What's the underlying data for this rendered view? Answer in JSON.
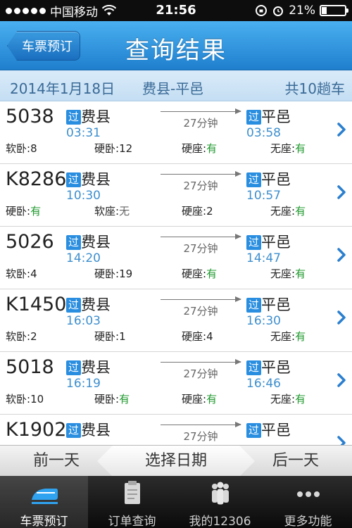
{
  "status_bar": {
    "carrier": "中国移动",
    "time": "21:56",
    "battery": "21%",
    "battery_level": 0.21
  },
  "nav": {
    "back_label": "车票预订",
    "title": "查询结果"
  },
  "info": {
    "date": "2014年1月18日",
    "route": "费县-平邑",
    "count": "共10趟车"
  },
  "trains": [
    {
      "number": "5038",
      "badge_from": "过",
      "from": "费县",
      "badge_to": "过",
      "to": "平邑",
      "duration": "27分钟",
      "depart": "03:31",
      "arrive": "03:58",
      "seats": [
        {
          "label": "软卧:",
          "value": "8",
          "color": "normal"
        },
        {
          "label": "硬卧:",
          "value": "12",
          "color": "normal"
        },
        {
          "label": "硬座:",
          "value": "有",
          "color": "green"
        },
        {
          "label": "无座:",
          "value": "有",
          "color": "green"
        }
      ]
    },
    {
      "number": "K8286",
      "badge_from": "过",
      "from": "费县",
      "badge_to": "过",
      "to": "平邑",
      "duration": "27分钟",
      "depart": "10:30",
      "arrive": "10:57",
      "seats": [
        {
          "label": "硬卧:",
          "value": "有",
          "color": "green"
        },
        {
          "label": "软座:",
          "value": "无",
          "color": "none"
        },
        {
          "label": "硬座:",
          "value": "2",
          "color": "normal"
        },
        {
          "label": "无座:",
          "value": "有",
          "color": "green"
        }
      ]
    },
    {
      "number": "5026",
      "badge_from": "过",
      "from": "费县",
      "badge_to": "过",
      "to": "平邑",
      "duration": "27分钟",
      "depart": "14:20",
      "arrive": "14:47",
      "seats": [
        {
          "label": "软卧:",
          "value": "4",
          "color": "normal"
        },
        {
          "label": "硬卧:",
          "value": "19",
          "color": "normal"
        },
        {
          "label": "硬座:",
          "value": "有",
          "color": "green"
        },
        {
          "label": "无座:",
          "value": "有",
          "color": "green"
        }
      ]
    },
    {
      "number": "K1450",
      "badge_from": "过",
      "from": "费县",
      "badge_to": "过",
      "to": "平邑",
      "duration": "27分钟",
      "depart": "16:03",
      "arrive": "16:30",
      "seats": [
        {
          "label": "软卧:",
          "value": "2",
          "color": "normal"
        },
        {
          "label": "硬卧:",
          "value": "1",
          "color": "normal"
        },
        {
          "label": "硬座:",
          "value": "4",
          "color": "normal"
        },
        {
          "label": "无座:",
          "value": "有",
          "color": "green"
        }
      ]
    },
    {
      "number": "5018",
      "badge_from": "过",
      "from": "费县",
      "badge_to": "过",
      "to": "平邑",
      "duration": "27分钟",
      "depart": "16:19",
      "arrive": "16:46",
      "seats": [
        {
          "label": "软卧:",
          "value": "10",
          "color": "normal"
        },
        {
          "label": "硬卧:",
          "value": "有",
          "color": "green"
        },
        {
          "label": "硬座:",
          "value": "有",
          "color": "green"
        },
        {
          "label": "无座:",
          "value": "有",
          "color": "green"
        }
      ]
    },
    {
      "number": "K1902",
      "badge_from": "过",
      "from": "费县",
      "badge_to": "过",
      "to": "平邑",
      "duration": "27分钟",
      "depart": "",
      "arrive": "",
      "seats": []
    }
  ],
  "date_bar": {
    "prev": "前一天",
    "select": "选择日期",
    "next": "后一天"
  },
  "tabs": [
    {
      "label": "车票预订",
      "icon": "train-icon",
      "active": true
    },
    {
      "label": "订单查询",
      "icon": "clipboard-icon",
      "active": false
    },
    {
      "label": "我的12306",
      "icon": "people-icon",
      "active": false
    },
    {
      "label": "更多功能",
      "icon": "more-icon",
      "active": false
    }
  ],
  "colors": {
    "nav_blue": "#2a8ee0",
    "time_blue": "#3e8fce",
    "available_green": "#1f9a2e"
  }
}
